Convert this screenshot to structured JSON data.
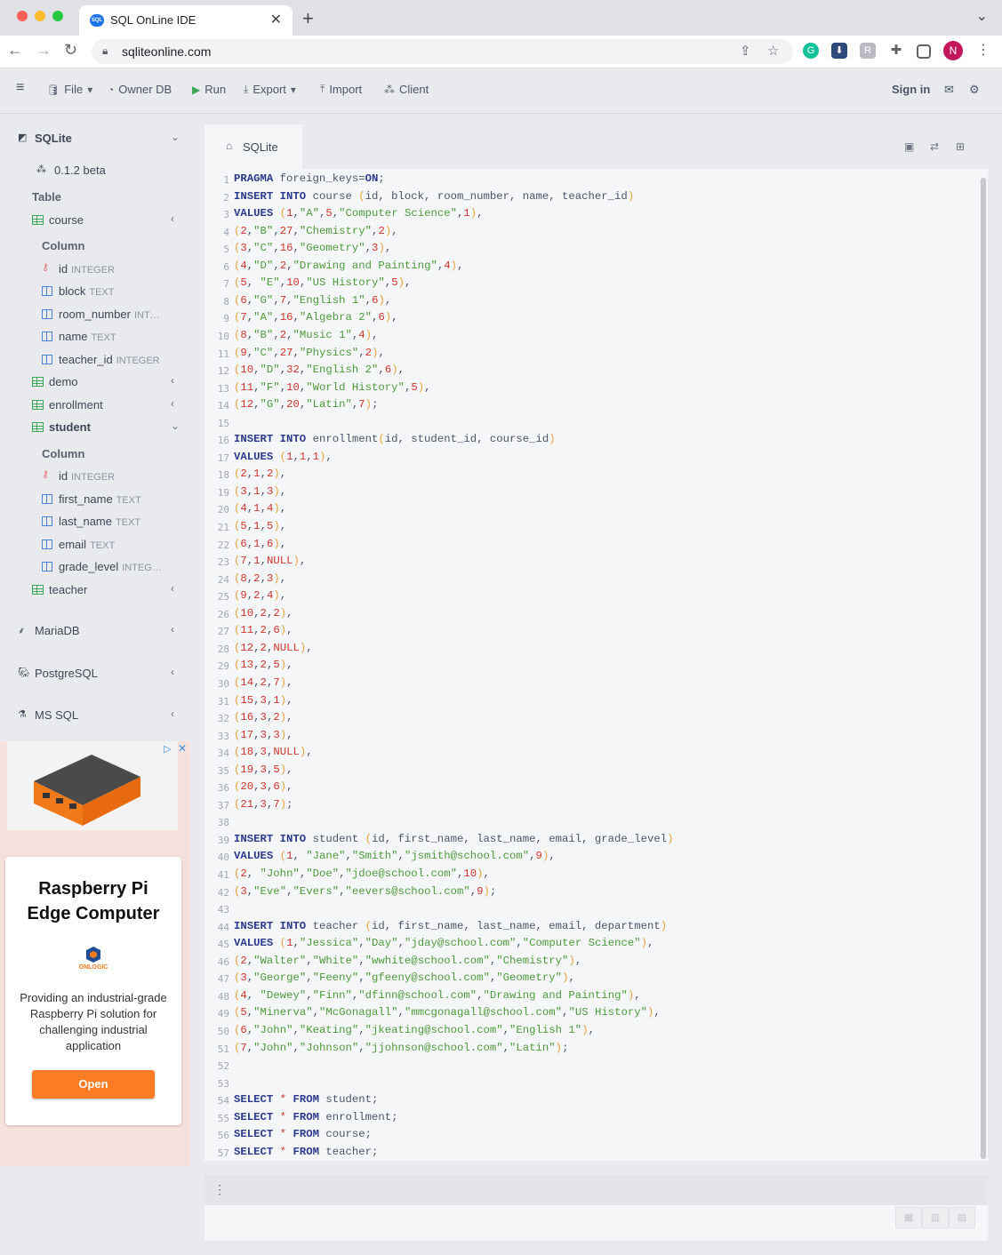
{
  "browser": {
    "tab_title": "SQL OnLine IDE",
    "url": "sqliteonline.com",
    "profile_initial": "N"
  },
  "appbar": {
    "file": "File",
    "owner_db": "Owner DB",
    "run": "Run",
    "export": "Export",
    "import": "Import",
    "client": "Client",
    "sign_in": "Sign in"
  },
  "sidebar": {
    "sqlite": "SQLite",
    "version": "0.1.2 beta",
    "table_heading": "Table",
    "course": "course",
    "column_heading": "Column",
    "course_columns": [
      {
        "name": "id",
        "type": "INTEGER"
      },
      {
        "name": "block",
        "type": "TEXT"
      },
      {
        "name": "room_number",
        "type": "INT…"
      },
      {
        "name": "name",
        "type": "TEXT"
      },
      {
        "name": "teacher_id",
        "type": "INTEGER"
      }
    ],
    "demo": "demo",
    "enrollment": "enrollment",
    "student": "student",
    "student_columns": [
      {
        "name": "id",
        "type": "INTEGER"
      },
      {
        "name": "first_name",
        "type": "TEXT"
      },
      {
        "name": "last_name",
        "type": "TEXT"
      },
      {
        "name": "email",
        "type": "TEXT"
      },
      {
        "name": "grade_level",
        "type": "INTEG…"
      }
    ],
    "teacher": "teacher",
    "mariadb": "MariaDB",
    "postgresql": "PostgreSQL",
    "mssql": "MS SQL"
  },
  "ad": {
    "title": "Raspberry Pi Edge Computer",
    "brand": "ONLOGIC",
    "text": "Providing an industrial-grade Raspberry Pi solution for challenging industrial application",
    "button": "Open"
  },
  "editor": {
    "tab_label": "SQLite",
    "lines": [
      "PRAGMA foreign_keys=ON;",
      "INSERT INTO course (id, block, room_number, name, teacher_id)",
      "VALUES (1,\"A\",5,\"Computer Science\",1),",
      "(2,\"B\",27,\"Chemistry\",2),",
      "(3,\"C\",16,\"Geometry\",3),",
      "(4,\"D\",2,\"Drawing and Painting\",4),",
      "(5, \"E\",10,\"US History\",5),",
      "(6,\"G\",7,\"English 1\",6),",
      "(7,\"A\",16,\"Algebra 2\",6),",
      "(8,\"B\",2,\"Music 1\",4),",
      "(9,\"C\",27,\"Physics\",2),",
      "(10,\"D\",32,\"English 2\",6),",
      "(11,\"F\",10,\"World History\",5),",
      "(12,\"G\",20,\"Latin\",7);",
      "",
      "INSERT INTO enrollment(id, student_id, course_id)",
      "VALUES (1,1,1),",
      "(2,1,2),",
      "(3,1,3),",
      "(4,1,4),",
      "(5,1,5),",
      "(6,1,6),",
      "(7,1,NULL),",
      "(8,2,3),",
      "(9,2,4),",
      "(10,2,2),",
      "(11,2,6),",
      "(12,2,NULL),",
      "(13,2,5),",
      "(14,2,7),",
      "(15,3,1),",
      "(16,3,2),",
      "(17,3,3),",
      "(18,3,NULL),",
      "(19,3,5),",
      "(20,3,6),",
      "(21,3,7);",
      "",
      "INSERT INTO student (id, first_name, last_name, email, grade_level)",
      "VALUES (1, \"Jane\",\"Smith\",\"jsmith@school.com\",9),",
      "(2, \"John\",\"Doe\",\"jdoe@school.com\",10),",
      "(3,\"Eve\",\"Evers\",\"eevers@school.com\",9);",
      "",
      "INSERT INTO teacher (id, first_name, last_name, email, department)",
      "VALUES (1,\"Jessica\",\"Day\",\"jday@school.com\",\"Computer Science\"),",
      "(2,\"Walter\",\"White\",\"wwhite@school.com\",\"Chemistry\"),",
      "(3,\"George\",\"Feeny\",\"gfeeny@school.com\",\"Geometry\"),",
      "(4, \"Dewey\",\"Finn\",\"dfinn@school.com\",\"Drawing and Painting\"),",
      "(5,\"Minerva\",\"McGonagall\",\"mmcgonagall@school.com\",\"US History\"),",
      "(6,\"John\",\"Keating\",\"jkeating@school.com\",\"English 1\"),",
      "(7,\"John\",\"Johnson\",\"jjohnson@school.com\",\"Latin\");",
      "",
      "",
      "SELECT * FROM student;",
      "SELECT * FROM enrollment;",
      "SELECT * FROM course;",
      "SELECT * FROM teacher;"
    ]
  },
  "colors": {
    "keyword": "#2b3a8c",
    "number": "#d0342c",
    "string": "#4d9a3a",
    "paren": "#e6a23c",
    "run_green": "#3aa757",
    "ad_button": "#fb7c25"
  }
}
